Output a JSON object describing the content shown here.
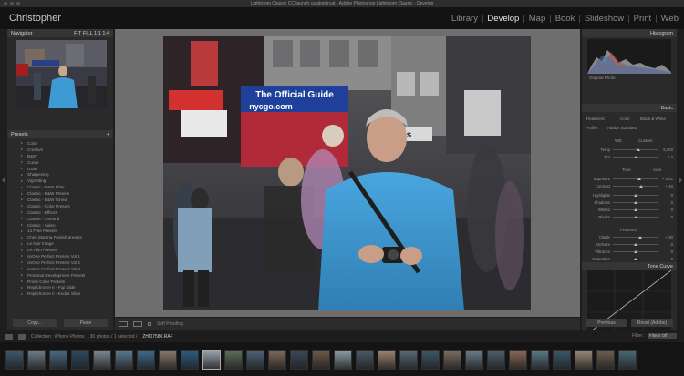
{
  "window": {
    "title": "Lightroom Classic CC launch catalog.lrcat - Adobe Photoshop Lightroom Classic - Develop"
  },
  "identity": {
    "user": "Christopher",
    "modules": [
      {
        "label": "Library",
        "active": false
      },
      {
        "label": "Develop",
        "active": true
      },
      {
        "label": "Map",
        "active": false
      },
      {
        "label": "Book",
        "active": false
      },
      {
        "label": "Slideshow",
        "active": false
      },
      {
        "label": "Print",
        "active": false
      },
      {
        "label": "Web",
        "active": false
      }
    ]
  },
  "left_panel": {
    "navigator": {
      "title": "Navigator",
      "zoom": "FIT  FILL  1:1  1:4"
    },
    "presets": {
      "title": "Presets"
    },
    "preset_items": [
      "Color",
      "Creative",
      "B&W",
      "Curve",
      "Grain",
      "Sharpening",
      "Vignetting",
      "Classic - B&W Filter",
      "Classic - B&W Presets",
      "Classic - B&W Toned",
      "Classic - Color Presets",
      "Classic - Effects",
      "Classic - General",
      "Classic - Video",
      "14 Free Presets",
      "Chris Martina Foolish presets",
      "Le Noir Image",
      "LR Film Presets",
      "onOne Perfect Presets Vol 1",
      "onOne Perfect Presets Vol 2",
      "onOne Perfect Presets Vol 3",
      "Personal Development Presets",
      "Prime Color Presets",
      "Replichrome II - Fuji Slide",
      "Replichrome II - Kodak Slide"
    ],
    "copy_label": "Copy...",
    "paste_label": "Paste"
  },
  "photo": {
    "sign_text_1": "The Official Guide",
    "sign_text_2": "nycgo.com",
    "sign_text_3": "Lids"
  },
  "toolbar": {
    "soft_proofing": "Soft Proofing"
  },
  "right_panel": {
    "histogram_title": "Histogram",
    "original_photo": "Original Photo",
    "basic_title": "Basic",
    "treatment": "Treatment:",
    "color": "Color",
    "bw": "Black & White",
    "profile_label": "Profile:",
    "profile_value": "Adobe Standard",
    "wb_label": "WB:",
    "wb_value": "Custom",
    "rows": [
      {
        "label": "Temp",
        "value": "5,600",
        "pos": 0.55
      },
      {
        "label": "Tint",
        "value": "+ 2",
        "pos": 0.5
      },
      {
        "label": "Exposure",
        "value": "+ 0.41",
        "pos": 0.58
      },
      {
        "label": "Contrast",
        "value": "+ 40",
        "pos": 0.62
      },
      {
        "label": "Highlights",
        "value": "0",
        "pos": 0.5
      },
      {
        "label": "Shadows",
        "value": "0",
        "pos": 0.5
      },
      {
        "label": "Whites",
        "value": "0",
        "pos": 0.5
      },
      {
        "label": "Blacks",
        "value": "0",
        "pos": 0.5
      },
      {
        "label": "Clarity",
        "value": "+ 30",
        "pos": 0.6
      },
      {
        "label": "Dehaze",
        "value": "0",
        "pos": 0.5
      },
      {
        "label": "Vibrance",
        "value": "0",
        "pos": 0.5
      },
      {
        "label": "Saturation",
        "value": "0",
        "pos": 0.5
      }
    ],
    "tone_label": "Tone",
    "tone_auto": "Auto",
    "presence_label": "Presence",
    "tone_curve_title": "Tone Curve",
    "previous_label": "Previous",
    "reset_label": "Reset (Adobe)"
  },
  "filmbar": {
    "collection": "Collection : iPhone Photos",
    "count": "30 photos / 1 selected /",
    "filename": "ZHI07580.RAF",
    "filter_label": "Filter :",
    "filter_value": "Filters Off"
  },
  "filmstrip": {
    "thumb_count": 29,
    "selected_index": 9
  }
}
